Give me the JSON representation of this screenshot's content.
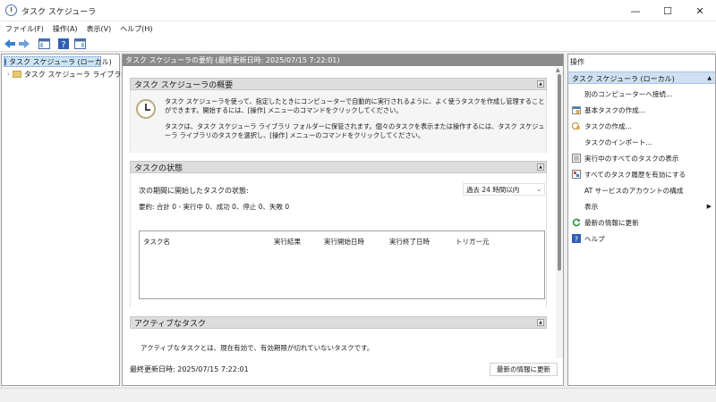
{
  "window": {
    "title": "タスク スケジューラ"
  },
  "menu": [
    "ファイル(F)",
    "操作(A)",
    "表示(V)",
    "ヘルプ(H)"
  ],
  "tree": {
    "root": "タスク スケジューラ (ローカル)",
    "library": "タスク スケジューラ ライブラリ"
  },
  "center": {
    "header": "タスク スケジューラの要約 (最終更新日時: 2025/07/15 7:22:01)",
    "overview": {
      "title": "タスク スケジューラの概要",
      "para1": "タスク スケジューラを使って、指定したときにコンピューターで自動的に実行されるように、よく使うタスクを作成し管理することができます。開始するには、[操作] メニューのコマンドをクリックしてください。",
      "para2": "タスクは、タスク スケジューラ ライブラリ フォルダーに保管されます。個々のタスクを表示または操作するには、タスク スケジューラ ライブラリのタスクを選択し、[操作] メニューのコマンドをクリックしてください。"
    },
    "status": {
      "title": "タスクの状態",
      "label": "次の期間に開始したタスクの状態:",
      "period": "過去 24 時間以内",
      "summary": "要約: 合計 0 - 実行中 0、成功 0、停止 0、失敗 0",
      "columns": [
        "タスク名",
        "実行結果",
        "実行開始日時",
        "実行終了日時",
        "トリガー元"
      ]
    },
    "active": {
      "title": "アクティブなタスク",
      "desc": "アクティブなタスクとは、現在有効で、有効期限が切れていないタスクです。"
    },
    "last_updated": "最終更新日時: 2025/07/15 7:22:01",
    "refresh_button": "最新の情報に更新"
  },
  "actions": {
    "header": "操作",
    "subheader": "タスク スケジューラ (ローカル)",
    "items": [
      {
        "label": "別のコンピューターへ接続...",
        "icon": ""
      },
      {
        "label": "基本タスクの作成...",
        "icon": "basic-task-icon"
      },
      {
        "label": "タスクの作成...",
        "icon": "create-task-icon"
      },
      {
        "label": "タスクのインポート...",
        "icon": ""
      },
      {
        "label": "実行中のすべてのタスクの表示",
        "icon": "running-tasks-icon"
      },
      {
        "label": "すべてのタスク履歴を有効にする",
        "icon": "history-icon"
      },
      {
        "label": "AT サービスのアカウントの構成",
        "icon": ""
      },
      {
        "label": "表示",
        "icon": ""
      },
      {
        "label": "最新の情報に更新",
        "icon": "refresh-icon"
      },
      {
        "label": "ヘルプ",
        "icon": "help-icon"
      }
    ]
  }
}
